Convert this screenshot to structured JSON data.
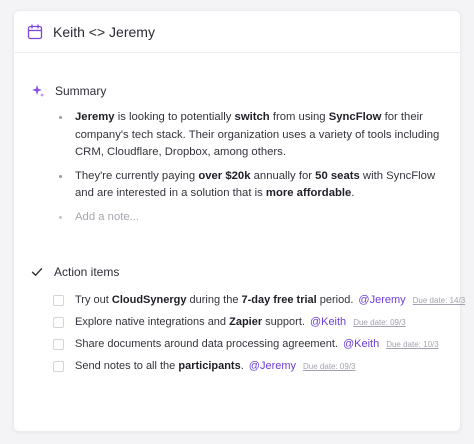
{
  "header": {
    "title": "Keith <> Jeremy",
    "icon": "calendar-icon"
  },
  "summary": {
    "label": "Summary",
    "icon": "sparkle-icon",
    "bullets": [
      {
        "parts": [
          {
            "text": "Jeremy",
            "bold": true
          },
          {
            "text": " is looking to potentially ",
            "bold": false
          },
          {
            "text": "switch",
            "bold": true
          },
          {
            "text": " from using ",
            "bold": false
          },
          {
            "text": "SyncFlow",
            "bold": true
          },
          {
            "text": " for their company's tech stack. Their organization uses a variety of tools including CRM, Cloudflare, Dropbox, among others.",
            "bold": false
          }
        ]
      },
      {
        "parts": [
          {
            "text": "They're currently paying ",
            "bold": false
          },
          {
            "text": "over $20k",
            "bold": true
          },
          {
            "text": " annually for ",
            "bold": false
          },
          {
            "text": "50 seats",
            "bold": true
          },
          {
            "text": " with SyncFlow and are interested in a solution that is ",
            "bold": false
          },
          {
            "text": "more affordable",
            "bold": true
          },
          {
            "text": ".",
            "bold": false
          }
        ]
      }
    ],
    "add_note_placeholder": "Add a note..."
  },
  "action_items": {
    "label": "Action items",
    "icon": "checkmark-icon",
    "items": [
      {
        "parts": [
          {
            "text": "Try out ",
            "bold": false
          },
          {
            "text": "CloudSynergy",
            "bold": true
          },
          {
            "text": " during the ",
            "bold": false
          },
          {
            "text": "7-day free trial",
            "bold": true
          },
          {
            "text": " period.",
            "bold": false
          }
        ],
        "assignee": "@Jeremy",
        "due": "Due date: 14/3"
      },
      {
        "parts": [
          {
            "text": "Explore native integrations and ",
            "bold": false
          },
          {
            "text": "Zapier",
            "bold": true
          },
          {
            "text": " support.",
            "bold": false
          }
        ],
        "assignee": "@Keith",
        "due": "Due date: 09/3"
      },
      {
        "parts": [
          {
            "text": "Share documents around data processing agreement.",
            "bold": false
          }
        ],
        "assignee": "@Keith",
        "due": "Due date: 10/3"
      },
      {
        "parts": [
          {
            "text": "Send notes to all the ",
            "bold": false
          },
          {
            "text": "participants",
            "bold": true
          },
          {
            "text": ".",
            "bold": false
          }
        ],
        "assignee": "@Jeremy",
        "due": "Due date: 09/3"
      }
    ]
  },
  "colors": {
    "accent": "#6b3ed6",
    "muted": "#a2a2ae"
  }
}
